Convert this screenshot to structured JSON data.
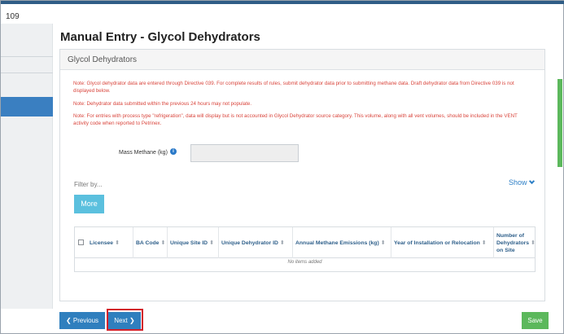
{
  "page": {
    "corner_number": "109",
    "title": "Manual Entry - Glycol Dehydrators"
  },
  "panel": {
    "header": "Glycol Dehydrators",
    "notes": [
      "Note: Glycol dehydrator data are entered through Directive 039. For complete results of rules, submit dehydrator data prior to submitting methane data. Draft dehydrator data from Directive 039 is not displayed below.",
      "Note: Dehydrator data submitted within the previous 24 hours may not populate.",
      "Note: For entries with process type \"refrigeration\", data will display but is not accounted in Glycol Dehydrator source category. This volume, along with all vent volumes, should be included in the VENT activity code when reported to Petrinex."
    ],
    "mass_methane_label": "Mass Methane (kg)",
    "mass_methane_value": "",
    "filter_label": "Filter by...",
    "show_label": "Show",
    "more_label": "More"
  },
  "table": {
    "columns": [
      "Licensee",
      "BA Code",
      "Unique Site ID",
      "Unique Dehydrator ID",
      "Annual Methane Emissions (kg)",
      "Year of Installation or Relocation",
      "Number of Dehydrators on Site"
    ],
    "empty_message": "No items added"
  },
  "footer": {
    "previous_label": "Previous",
    "next_label": "Next",
    "save_label": "Save"
  },
  "icons": {
    "info": "info-icon",
    "sort": "sort-icon",
    "chevron_down": "chevron-down-icon",
    "chevron_left": "chevron-left-icon",
    "chevron_right": "chevron-right-icon"
  },
  "colors": {
    "primary": "#2f7fbe",
    "save": "#5cb85c",
    "more": "#5bc0de",
    "note_text": "#d9453c",
    "highlight": "#d3202a"
  }
}
